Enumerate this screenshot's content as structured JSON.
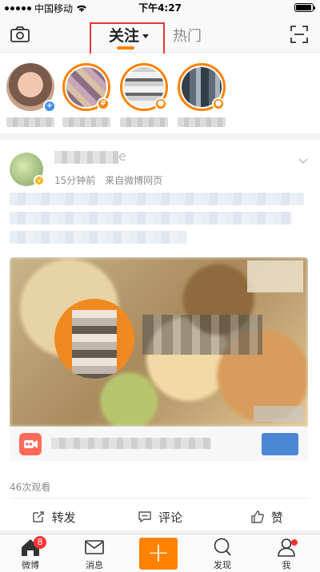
{
  "status_bar": {
    "carrier": "中国移动",
    "time": "下午4:27",
    "battery_level": 0.95
  },
  "navbar": {
    "tab_follow": "关注",
    "tab_hot": "热门",
    "left_icon": "camera-icon",
    "right_icon": "scan-icon"
  },
  "stories": [
    {
      "badge": "+",
      "badge_color": "#3d8ef0",
      "ring": false
    },
    {
      "badge": "#",
      "badge_color": "#ff8200",
      "ring": true
    },
    {
      "badge": "●",
      "badge_color": "#ff8200",
      "ring": true
    },
    {
      "badge": "●",
      "badge_color": "#ff8200",
      "ring": true
    }
  ],
  "post": {
    "name_tail": "e",
    "time": "15分钟前",
    "source": "来自微博网页",
    "view_count": "46次观看"
  },
  "actions": {
    "repost": "转发",
    "comment": "评论",
    "like": "赞"
  },
  "tabbar": {
    "home": "微博",
    "home_badge": "8",
    "messages": "消息",
    "compose": "+",
    "discover": "发现",
    "me": "我"
  },
  "colors": {
    "accent": "#ff8200",
    "annotation": "#e8323a"
  }
}
